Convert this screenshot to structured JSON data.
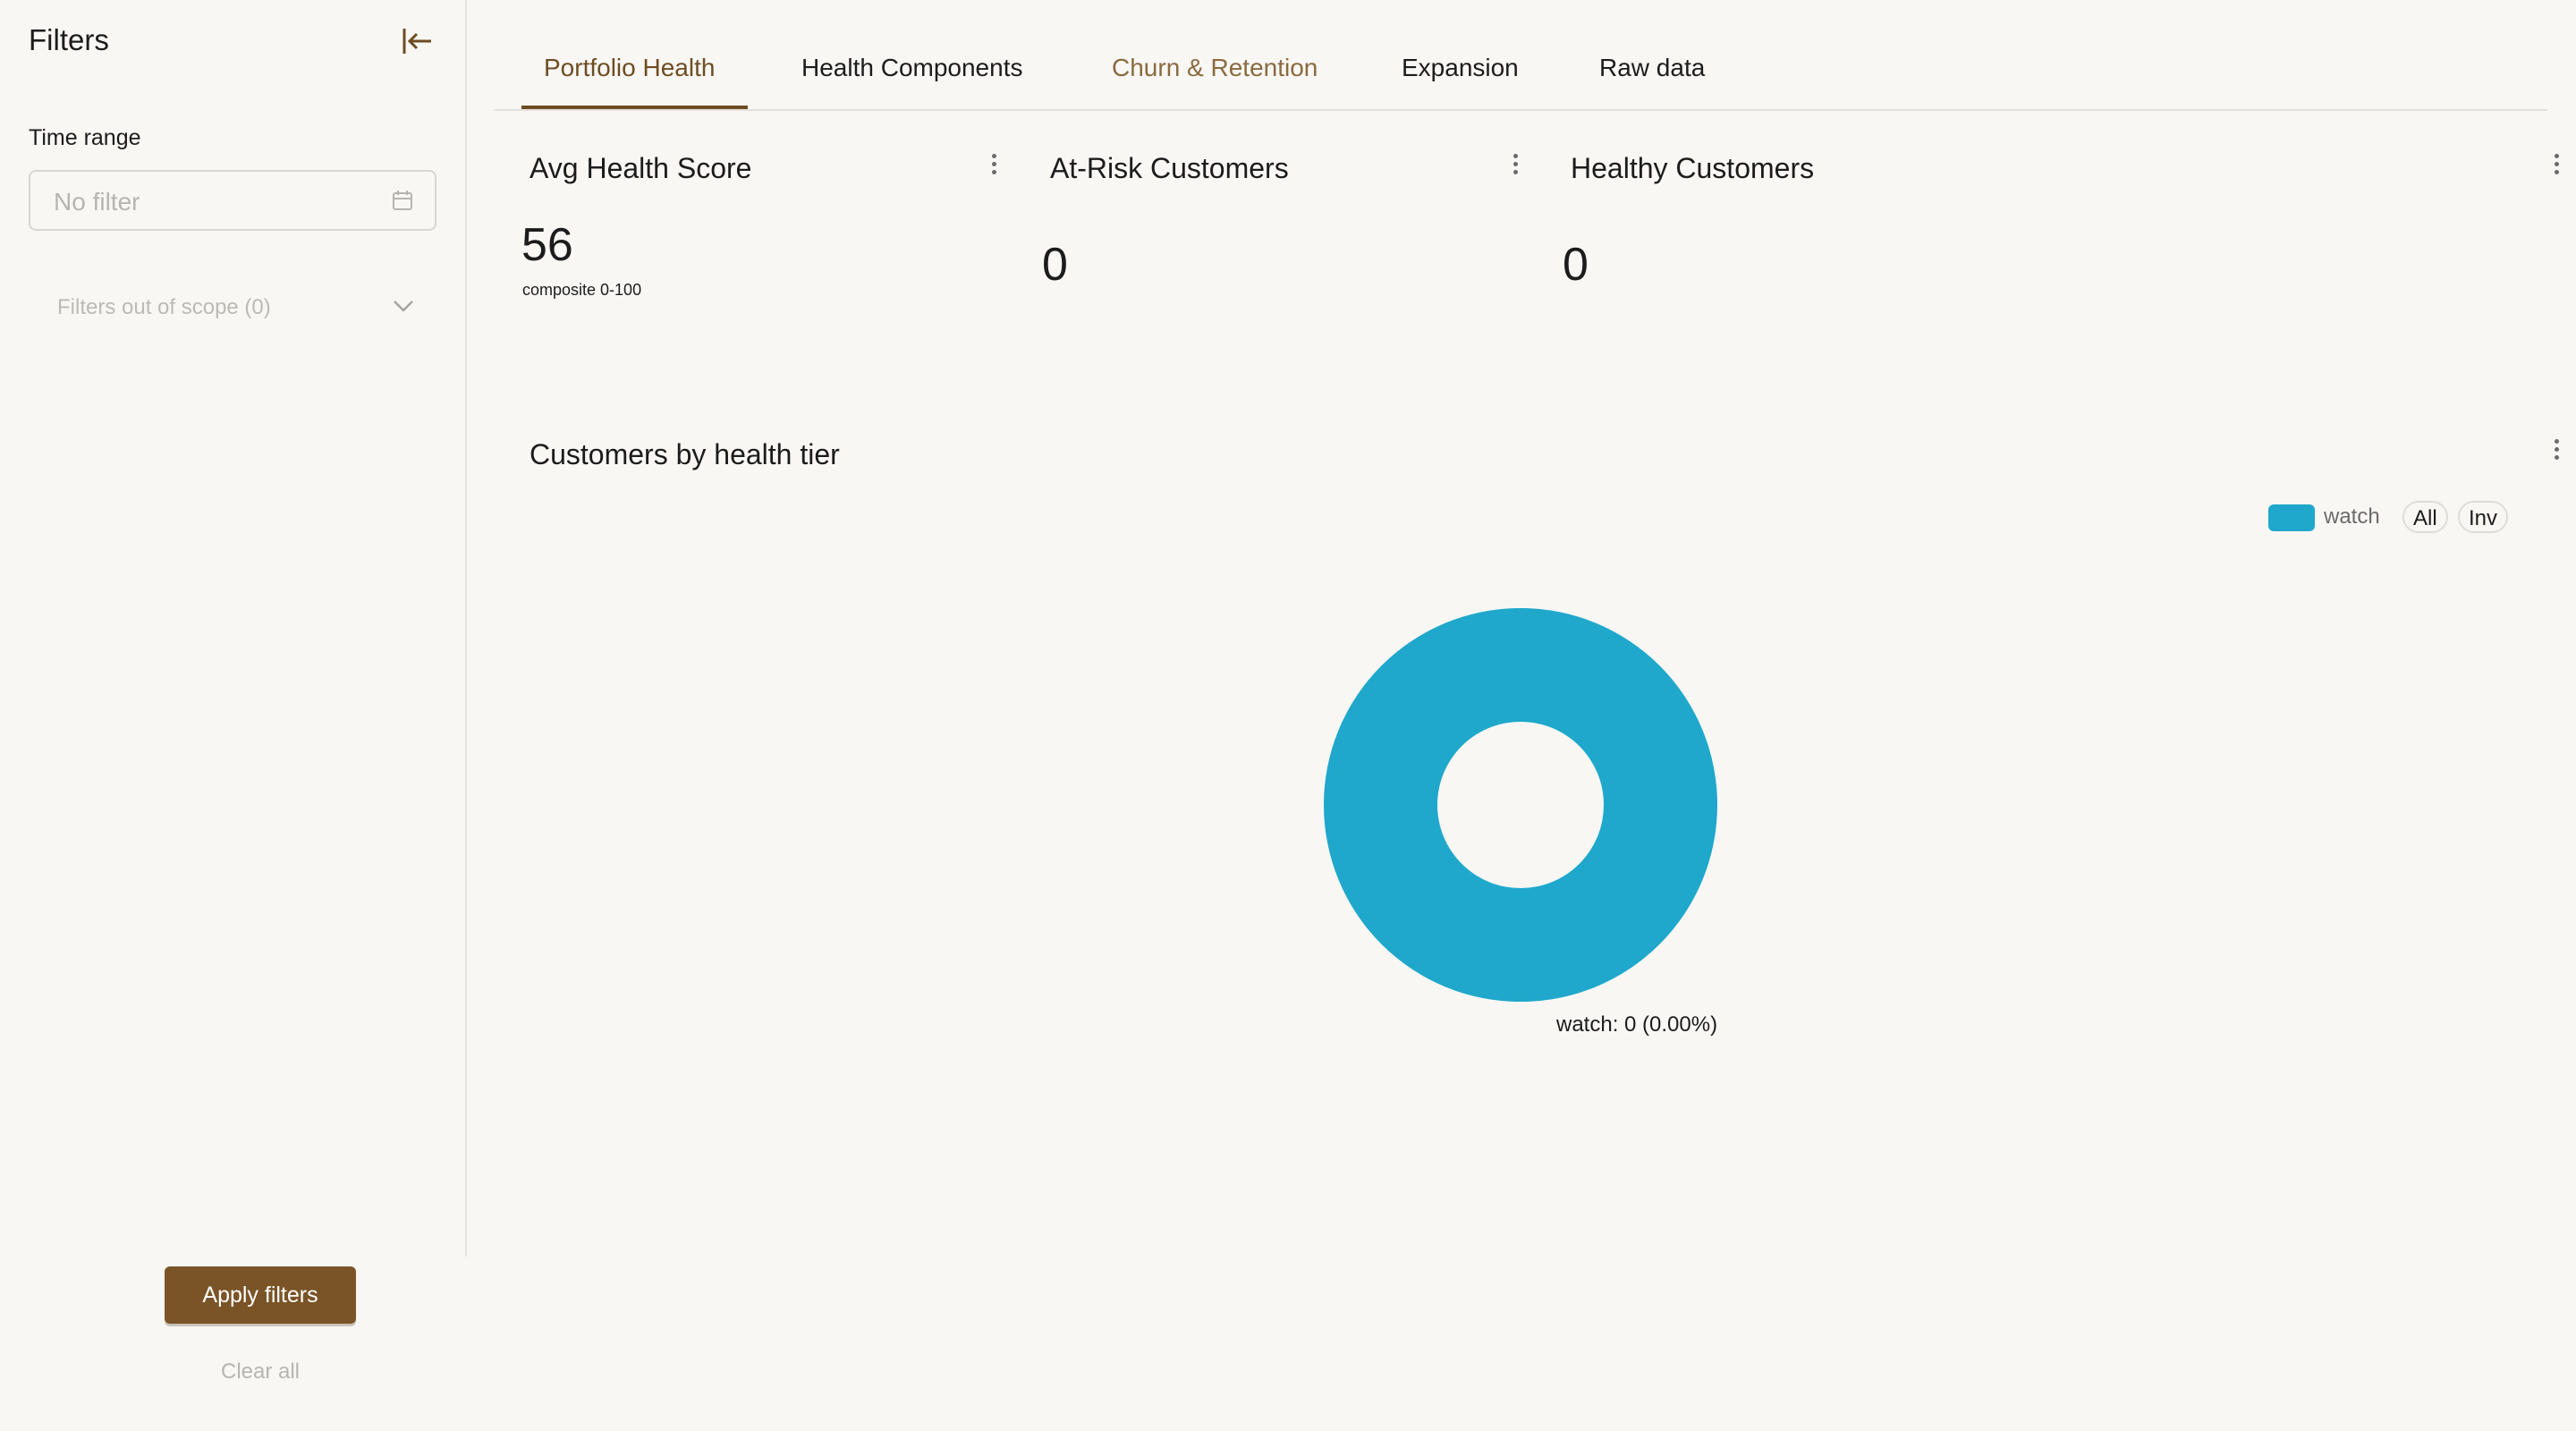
{
  "sidebar": {
    "title": "Filters",
    "time_range_label": "Time range",
    "time_range_placeholder": "No filter",
    "out_of_scope_label": "Filters out of scope (0)",
    "apply_label": "Apply filters",
    "clear_label": "Clear all"
  },
  "tabs": [
    {
      "label": "Portfolio Health",
      "state": "active"
    },
    {
      "label": "Health Components",
      "state": "normal"
    },
    {
      "label": "Churn & Retention",
      "state": "muted"
    },
    {
      "label": "Expansion",
      "state": "normal"
    },
    {
      "label": "Raw data",
      "state": "normal"
    }
  ],
  "metrics": [
    {
      "title": "Avg Health Score",
      "value": "56",
      "subtitle": "composite 0-100"
    },
    {
      "title": "At-Risk Customers",
      "value": "0"
    },
    {
      "title": "Healthy Customers",
      "value": "0"
    }
  ],
  "chart": {
    "title": "Customers by health tier",
    "legend_all": "All",
    "legend_inv": "Inv",
    "slice_label": "watch: 0 (0.00%)"
  },
  "chart_data": {
    "type": "pie",
    "title": "Customers by health tier",
    "donut": true,
    "categories": [
      "watch"
    ],
    "values": [
      0
    ],
    "percentages": [
      0.0
    ],
    "colors": [
      "#1fa8cc"
    ],
    "legend": "top-right"
  },
  "colors": {
    "accent": "#7a5427",
    "accent_text": "#6e4d22",
    "series_watch": "#1fa8cc",
    "background": "#f8f7f4"
  },
  "icons": {
    "collapse": "collapse-left-icon",
    "calendar": "calendar-icon",
    "chevron": "chevron-down-icon",
    "menu": "kebab-menu-icon"
  }
}
